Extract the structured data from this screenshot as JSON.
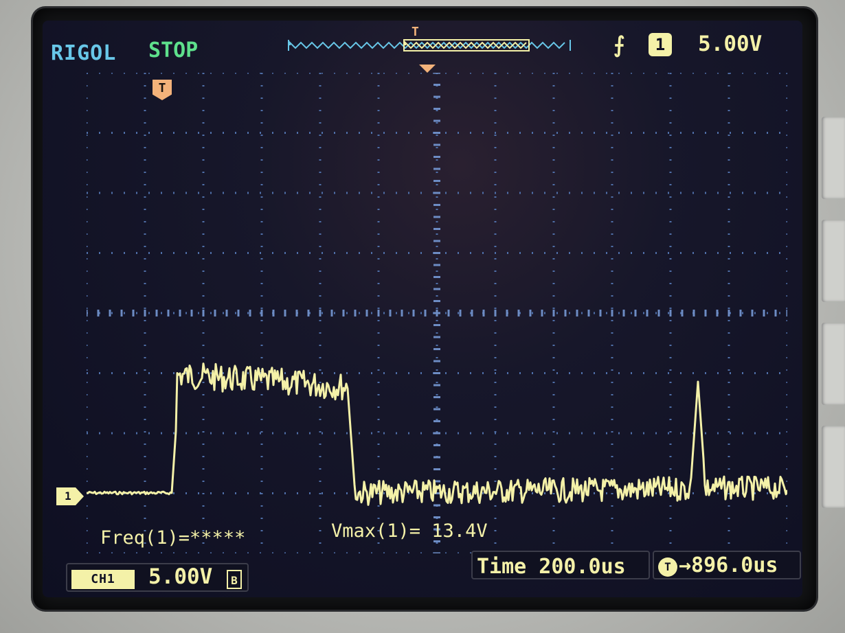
{
  "header": {
    "brand": "RIGOL",
    "run_status": "STOP",
    "trigger_channel": "1",
    "trigger_level": "5.00V",
    "trigger_edge_icon": "rising-edge-icon",
    "trigger_marker_label": "T",
    "memory_marker_label": "T"
  },
  "channel": {
    "marker_label": "1",
    "scale_tag": "CH1",
    "scale": "5.00V",
    "bandwidth_icon": "B"
  },
  "measurements": {
    "freq": "Freq(1)=*****",
    "vmax": "Vmax(1)= 13.4V"
  },
  "timebase": {
    "time": "Time 200.0us",
    "trigger_delay_icon": "T",
    "trigger_delay": "→896.0us"
  },
  "colors": {
    "trace": "#f4f1a8",
    "brand": "#68c7e8",
    "status": "#5ee08c",
    "trigger": "#f3b27a",
    "grid": "#4f6fa8"
  }
}
